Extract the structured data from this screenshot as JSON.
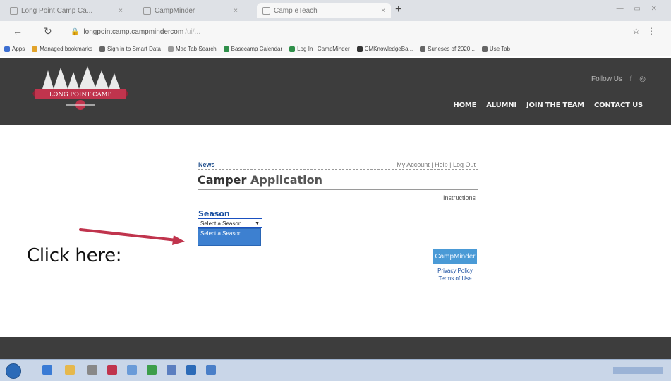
{
  "browser": {
    "tabs": [
      {
        "label": "Long Point Camp Ca...",
        "active": false
      },
      {
        "label": "CampMinder",
        "active": false
      },
      {
        "label": "Camp eTeach",
        "active": true
      }
    ],
    "address": {
      "host": "longpointcamp.campmindercom",
      "path": "/ui/..."
    },
    "bookmarks": [
      {
        "label": "Apps",
        "color": "#3d6fd1"
      },
      {
        "label": "Managed bookmarks",
        "color": "#e2a32a"
      },
      {
        "label": "Sign in to Smart Data",
        "color": "#666666"
      },
      {
        "label": "Mac Tab Search",
        "color": "#9a9a9a"
      },
      {
        "label": "Basecamp Calendar",
        "color": "#2f8f4a"
      },
      {
        "label": "Log In | CampMinder",
        "color": "#2f8f4a"
      },
      {
        "label": "CMKnowledgeBa...",
        "color": "#333333"
      },
      {
        "label": "Suneses of 2020...",
        "color": "#666666"
      },
      {
        "label": "Use Tab",
        "color": "#666666"
      }
    ]
  },
  "header": {
    "logo_text": "LONG POINT CAMP",
    "follow_text": "Follow Us",
    "nav": [
      "HOME",
      "ALUMNI",
      "JOIN THE TEAM",
      "CONTACT US"
    ]
  },
  "content": {
    "news_link": "News",
    "account_links": "My Account | Help | Log Out",
    "title_dark": "Camper",
    "title_light": " Application",
    "instructions": "Instructions",
    "season_label": "Season",
    "season_select_value": "Select a Season",
    "dropdown_options": [
      "Select a Season"
    ],
    "hint_text": "Click here:",
    "campminder_button": "CampMinder",
    "privacy_link": "Privacy Policy",
    "terms_link": "Terms of Use"
  },
  "colors": {
    "header_bg": "#3d3d3d",
    "link_blue": "#1a4fa0",
    "dropdown_highlight": "#3d80d0",
    "arrow_red": "#c0344d",
    "campminder_blue": "#4a9ad6"
  }
}
